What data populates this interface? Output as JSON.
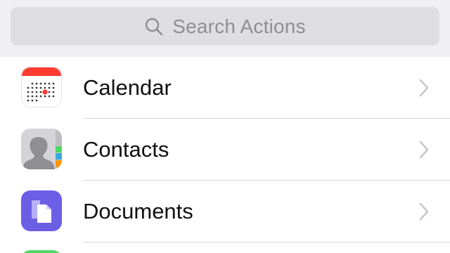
{
  "search": {
    "placeholder": "Search Actions",
    "icon": "search-icon"
  },
  "list": {
    "items": [
      {
        "label": "Calendar",
        "icon": "calendar-icon"
      },
      {
        "label": "Contacts",
        "icon": "contacts-icon"
      },
      {
        "label": "Documents",
        "icon": "documents-icon"
      }
    ],
    "partial_item_icon": "green-app-icon"
  },
  "colors": {
    "header_background": "#efeff4",
    "search_field": "#dddde2",
    "calendar_red": "#ff3b30",
    "documents_purple": "#6c5fe6",
    "partial_green": "#4cd964",
    "chevron": "#c7c7cc",
    "separator": "#d6d6da"
  }
}
